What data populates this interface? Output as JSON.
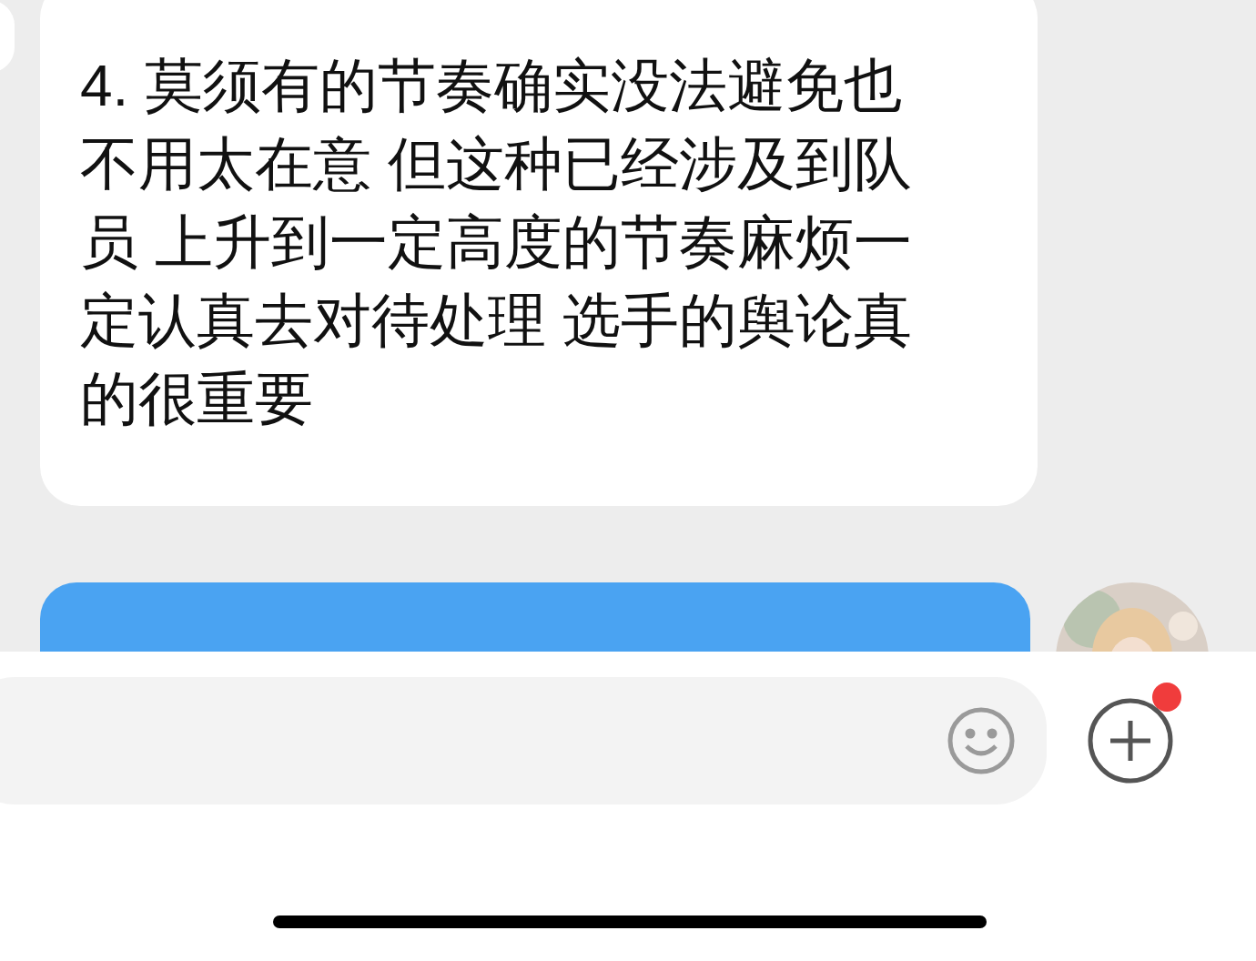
{
  "messages": [
    {
      "kind": "received",
      "text": "4. 莫须有的节奏确实没法避免也不用太在意 但这种已经涉及到队员 上升到一定高度的节奏麻烦一定认真去对待处理 选手的舆论真的很重要"
    },
    {
      "kind": "sent"
    }
  ],
  "composer": {
    "has_notification": true
  }
}
